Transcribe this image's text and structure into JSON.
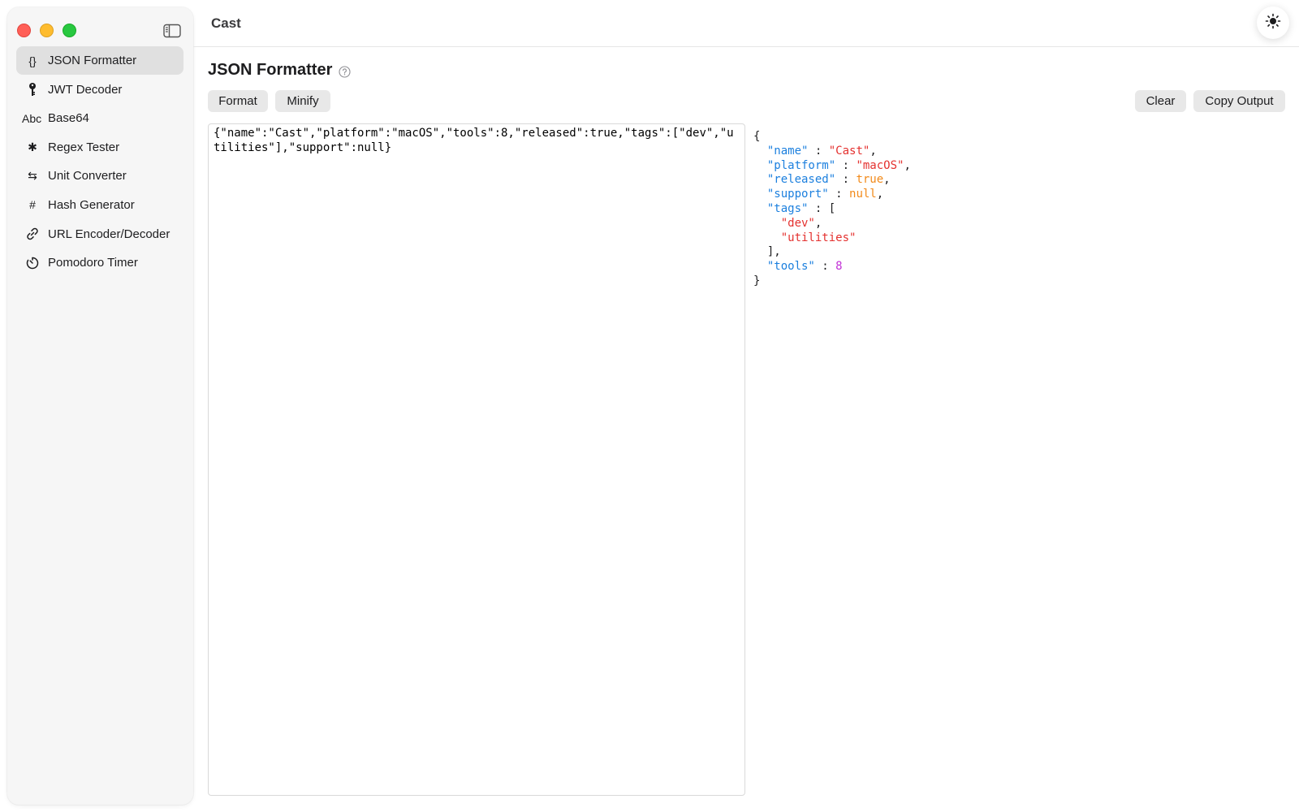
{
  "app": {
    "title": "Cast"
  },
  "sidebar": {
    "items": [
      {
        "label": "JSON Formatter",
        "icon": "curly-braces-icon",
        "glyph": "{}",
        "active": true
      },
      {
        "label": "JWT Decoder",
        "icon": "key-icon",
        "glyph": "",
        "active": false
      },
      {
        "label": "Base64",
        "icon": "abc-text-icon",
        "glyph": "Abc",
        "active": false
      },
      {
        "label": "Regex Tester",
        "icon": "asterisk-icon",
        "glyph": "✱",
        "active": false
      },
      {
        "label": "Unit Converter",
        "icon": "swap-arrows-icon",
        "glyph": "⇆",
        "active": false
      },
      {
        "label": "Hash Generator",
        "icon": "hash-icon",
        "glyph": "#",
        "active": false
      },
      {
        "label": "URL Encoder/Decoder",
        "icon": "link-icon",
        "glyph": "",
        "active": false
      },
      {
        "label": "Pomodoro Timer",
        "icon": "timer-icon",
        "glyph": "",
        "active": false
      }
    ]
  },
  "main": {
    "title": "JSON Formatter",
    "buttons": {
      "format": "Format",
      "minify": "Minify",
      "clear": "Clear",
      "copy_output": "Copy Output"
    },
    "input_value": "{\"name\":\"Cast\",\"platform\":\"macOS\",\"tools\":8,\"released\":true,\"tags\":[\"dev\",\"utilities\"],\"support\":null}",
    "output": {
      "open": "{",
      "close": "}",
      "lines": [
        {
          "key": "\"name\"",
          "value": "\"Cast\"",
          "type": "string",
          "comma": ","
        },
        {
          "key": "\"platform\"",
          "value": "\"macOS\"",
          "type": "string",
          "comma": ","
        },
        {
          "key": "\"released\"",
          "value": "true",
          "type": "bool",
          "comma": ","
        },
        {
          "key": "\"support\"",
          "value": "null",
          "type": "bool",
          "comma": ","
        }
      ],
      "tags_key": "\"tags\"",
      "tags_values": [
        "\"dev\"",
        "\"utilities\""
      ],
      "tags_close": "],",
      "tools_key": "\"tools\"",
      "tools_value": "8"
    }
  },
  "colors": {
    "key": "#1b7fde",
    "string": "#e4312f",
    "bool_null": "#f28a1a",
    "number": "#c232d6",
    "active_nav_bg": "#e0e0e0"
  }
}
